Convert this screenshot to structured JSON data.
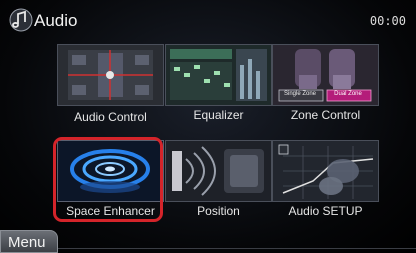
{
  "header": {
    "title": "Audio",
    "clock": "00:00"
  },
  "tiles": [
    {
      "label": "Audio Control"
    },
    {
      "label": "Equalizer"
    },
    {
      "label": "Zone Control",
      "zone_buttons": [
        "Single Zone",
        "Dual Zone"
      ]
    },
    {
      "label": "Space Enhancer"
    },
    {
      "label": "Position"
    },
    {
      "label": "Audio SETUP"
    }
  ],
  "selected_tile": "Space Enhancer",
  "colors": {
    "selection": "#d4242a",
    "accent_blue": "#2a8cff"
  },
  "footer": {
    "menu_label": "Menu"
  }
}
